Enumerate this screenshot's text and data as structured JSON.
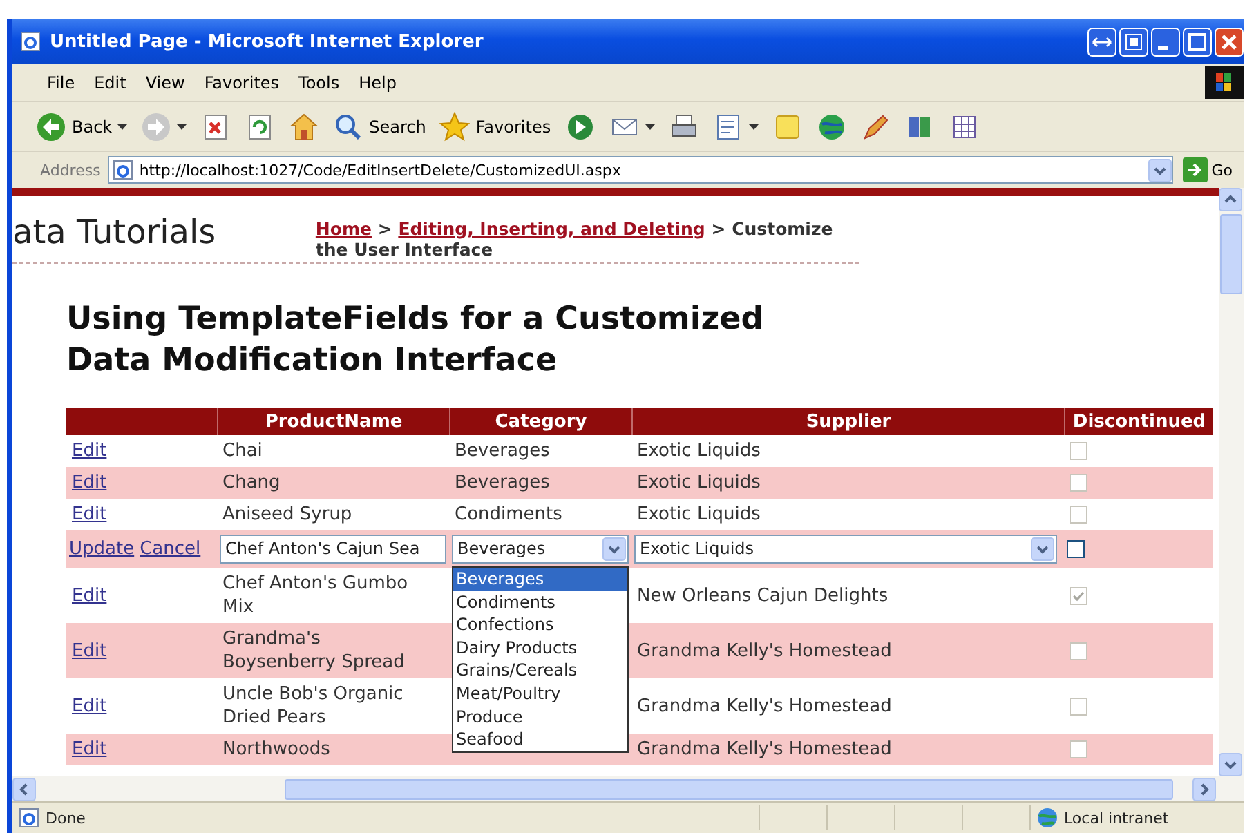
{
  "window": {
    "title": "Untitled Page - Microsoft Internet Explorer"
  },
  "menu": [
    "File",
    "Edit",
    "View",
    "Favorites",
    "Tools",
    "Help"
  ],
  "toolbar": [
    {
      "kind": "back",
      "label": "Back",
      "dropdown": true
    },
    {
      "kind": "forward",
      "dropdown": true
    },
    {
      "kind": "stop",
      "dropdown": false
    },
    {
      "kind": "refresh",
      "dropdown": false
    },
    {
      "kind": "home",
      "dropdown": false
    },
    {
      "kind": "search",
      "label": "Search",
      "dropdown": false
    },
    {
      "kind": "favorites",
      "label": "Favorites",
      "dropdown": false
    },
    {
      "kind": "media",
      "dropdown": false
    },
    {
      "kind": "mail",
      "dropdown": true
    },
    {
      "kind": "print",
      "dropdown": false
    },
    {
      "kind": "edit",
      "dropdown": true
    },
    {
      "kind": "note",
      "dropdown": false
    },
    {
      "kind": "globe",
      "dropdown": false
    },
    {
      "kind": "pencil",
      "dropdown": false
    },
    {
      "kind": "book",
      "dropdown": false
    },
    {
      "kind": "grid",
      "dropdown": false
    }
  ],
  "address": {
    "label": "Address",
    "url": "http://localhost:1027/Code/EditInsertDelete/CustomizedUI.aspx",
    "go": "Go"
  },
  "site": {
    "title": "ata Tutorials",
    "breadcrumb": [
      {
        "kind": "link",
        "text": "Home"
      },
      {
        "kind": "separator",
        "text": ">"
      },
      {
        "kind": "link",
        "text": "Editing, Inserting, and Deleting"
      },
      {
        "kind": "separator",
        "text": ">"
      },
      {
        "kind": "current",
        "text": "Customize the User Interface"
      }
    ]
  },
  "heading": "Using TemplateFields for a Customized Data Modification Interface",
  "columns": [
    "ProductName",
    "Category",
    "Supplier",
    "Discontinued"
  ],
  "rows": [
    {
      "kind": "view",
      "action": "Edit",
      "product": "Chai",
      "category": "Beverages",
      "supplier": "Exotic Liquids",
      "discontinued": false
    },
    {
      "kind": "view",
      "action": "Edit",
      "product": "Chang",
      "category": "Beverages",
      "supplier": "Exotic Liquids",
      "discontinued": false
    },
    {
      "kind": "view",
      "action": "Edit",
      "product": "Aniseed Syrup",
      "category": "Condiments",
      "supplier": "Exotic Liquids",
      "discontinued": false
    },
    {
      "kind": "edit",
      "actions": [
        "Update",
        "Cancel"
      ],
      "product": "Chef Anton's Cajun Sea",
      "category": "Beverages",
      "supplier": "Exotic Liquids",
      "discontinued": false,
      "category_options": [
        {
          "text": "Beverages",
          "selected": true
        },
        {
          "text": "Condiments",
          "selected": false
        },
        {
          "text": "Confections",
          "selected": false
        },
        {
          "text": "Dairy Products",
          "selected": false
        },
        {
          "text": "Grains/Cereals",
          "selected": false
        },
        {
          "text": "Meat/Poultry",
          "selected": false
        },
        {
          "text": "Produce",
          "selected": false
        },
        {
          "text": "Seafood",
          "selected": false
        }
      ]
    },
    {
      "kind": "view",
      "action": "Edit",
      "product": "Chef Anton's Gumbo Mix",
      "supplier": "New Orleans Cajun Delights",
      "discontinued": true
    },
    {
      "kind": "view",
      "action": "Edit",
      "product": "Grandma's Boysenberry Spread",
      "supplier": "Grandma Kelly's Homestead",
      "discontinued": false
    },
    {
      "kind": "view",
      "action": "Edit",
      "product": "Uncle Bob's Organic Dried Pears",
      "supplier": "Grandma Kelly's Homestead",
      "discontinued": false
    },
    {
      "kind": "view",
      "action": "Edit",
      "product": "Northwoods",
      "supplier": "Grandma Kelly's Homestead",
      "discontinued": false
    }
  ],
  "status": {
    "text": "Done",
    "zone": "Local intranet"
  }
}
